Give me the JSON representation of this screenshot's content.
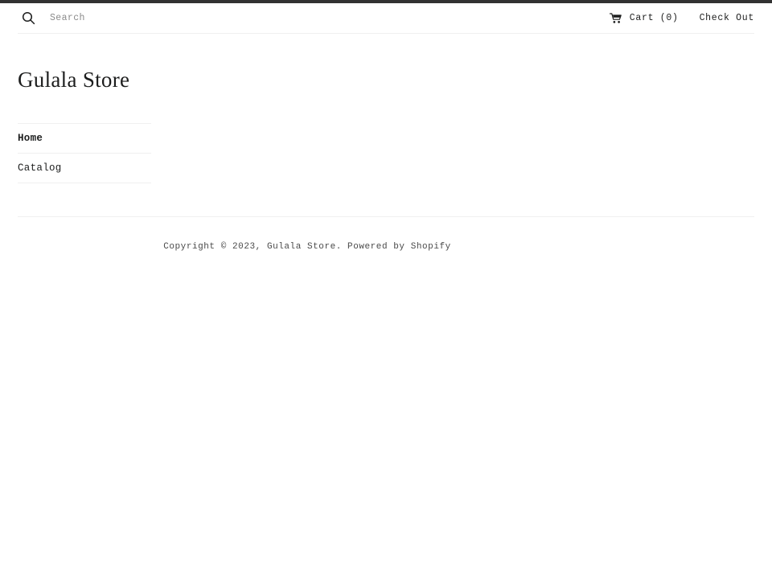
{
  "header": {
    "search": {
      "icon": "search-icon",
      "placeholder": "Search",
      "value": ""
    },
    "cart": {
      "icon": "shopping-cart-icon",
      "label": "Cart (0)",
      "count": 0
    },
    "checkout": {
      "label": "Check Out"
    }
  },
  "store": {
    "title": "Gulala Store"
  },
  "nav": {
    "items": [
      {
        "label": "Home",
        "active": true
      },
      {
        "label": "Catalog",
        "active": false
      }
    ]
  },
  "footer": {
    "copyright": "Copyright © 2023, Gulala Store. Powered by Shopify"
  },
  "colors": {
    "top_bar": "#323232",
    "text": "#1c1d1d",
    "muted_text": "#8b8b8b",
    "divider": "#f0f0f0",
    "background": "#ffffff"
  }
}
